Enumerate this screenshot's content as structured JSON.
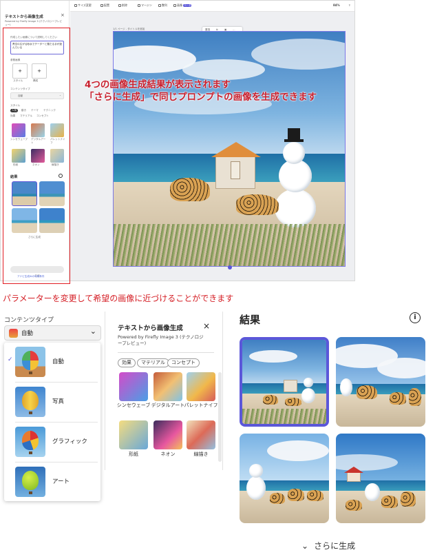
{
  "panel": {
    "title": "テキストから画像生成",
    "powered": "Powered by Firefly Image 3 (テクノロジープレビュー)",
    "prompt_label": "作成したい画像について説明してください",
    "prompt_value": "青空の広がる砂浜でチーターと雪だるまが遊んでいる",
    "reference_label": "参照画像",
    "ref_items": [
      "スタイル",
      "構成"
    ],
    "content_type_label": "コンテンツタイプ",
    "content_type_value": "自動",
    "style_label": "スタイル",
    "style_tabs": [
      "人気",
      "動き",
      "テーマ",
      "テクニック",
      "効果",
      "マテリアル",
      "コンセプト"
    ],
    "style_items": [
      "シンセウェーブ",
      "デジタルアート",
      "パレットナイフ",
      "形紙",
      "ネオン",
      "線描き"
    ],
    "results_label": "結果",
    "more_label": "さらに生成",
    "generate_label": "生成",
    "footer_link": "アドビ生成AIの利用条件"
  },
  "canvas": {
    "toolbar_items": [
      "サイズ変更",
      "配置",
      "削除",
      "マージン",
      "整列",
      "画像"
    ],
    "badge": "ベータ",
    "zoom": "84%",
    "page_label": "1/1 ページ - タイトルを追加",
    "float_tools": [
      "置換",
      "生成"
    ]
  },
  "annotations": {
    "line1": "4つの画像生成結果が表示されます",
    "line2": "「さらに生成」で同じプロンプトの画像を生成できます",
    "caption": "パラメーターを変更して希望の画像に近づけることができます"
  },
  "dropdown": {
    "label": "コンテンツタイプ",
    "selected": "自動",
    "options": [
      "自動",
      "写真",
      "グラフィック",
      "アート"
    ]
  },
  "mid_panel": {
    "title": "テキストから画像生成",
    "powered": "Powered by Firefly Image 3 (テクノロジープレビュー)",
    "chips": [
      "効果",
      "マテリアル",
      "コンセプト"
    ],
    "styles": [
      "シンセウェーブ",
      "デジタルアート",
      "パレットナイフ",
      "形紙",
      "ネオン",
      "線描き"
    ]
  },
  "results": {
    "title": "結果",
    "more": "さらに生成"
  },
  "colors": {
    "accent": "#5b57d9",
    "annotation_red": "#c8202e",
    "box_red": "#e11b22"
  }
}
